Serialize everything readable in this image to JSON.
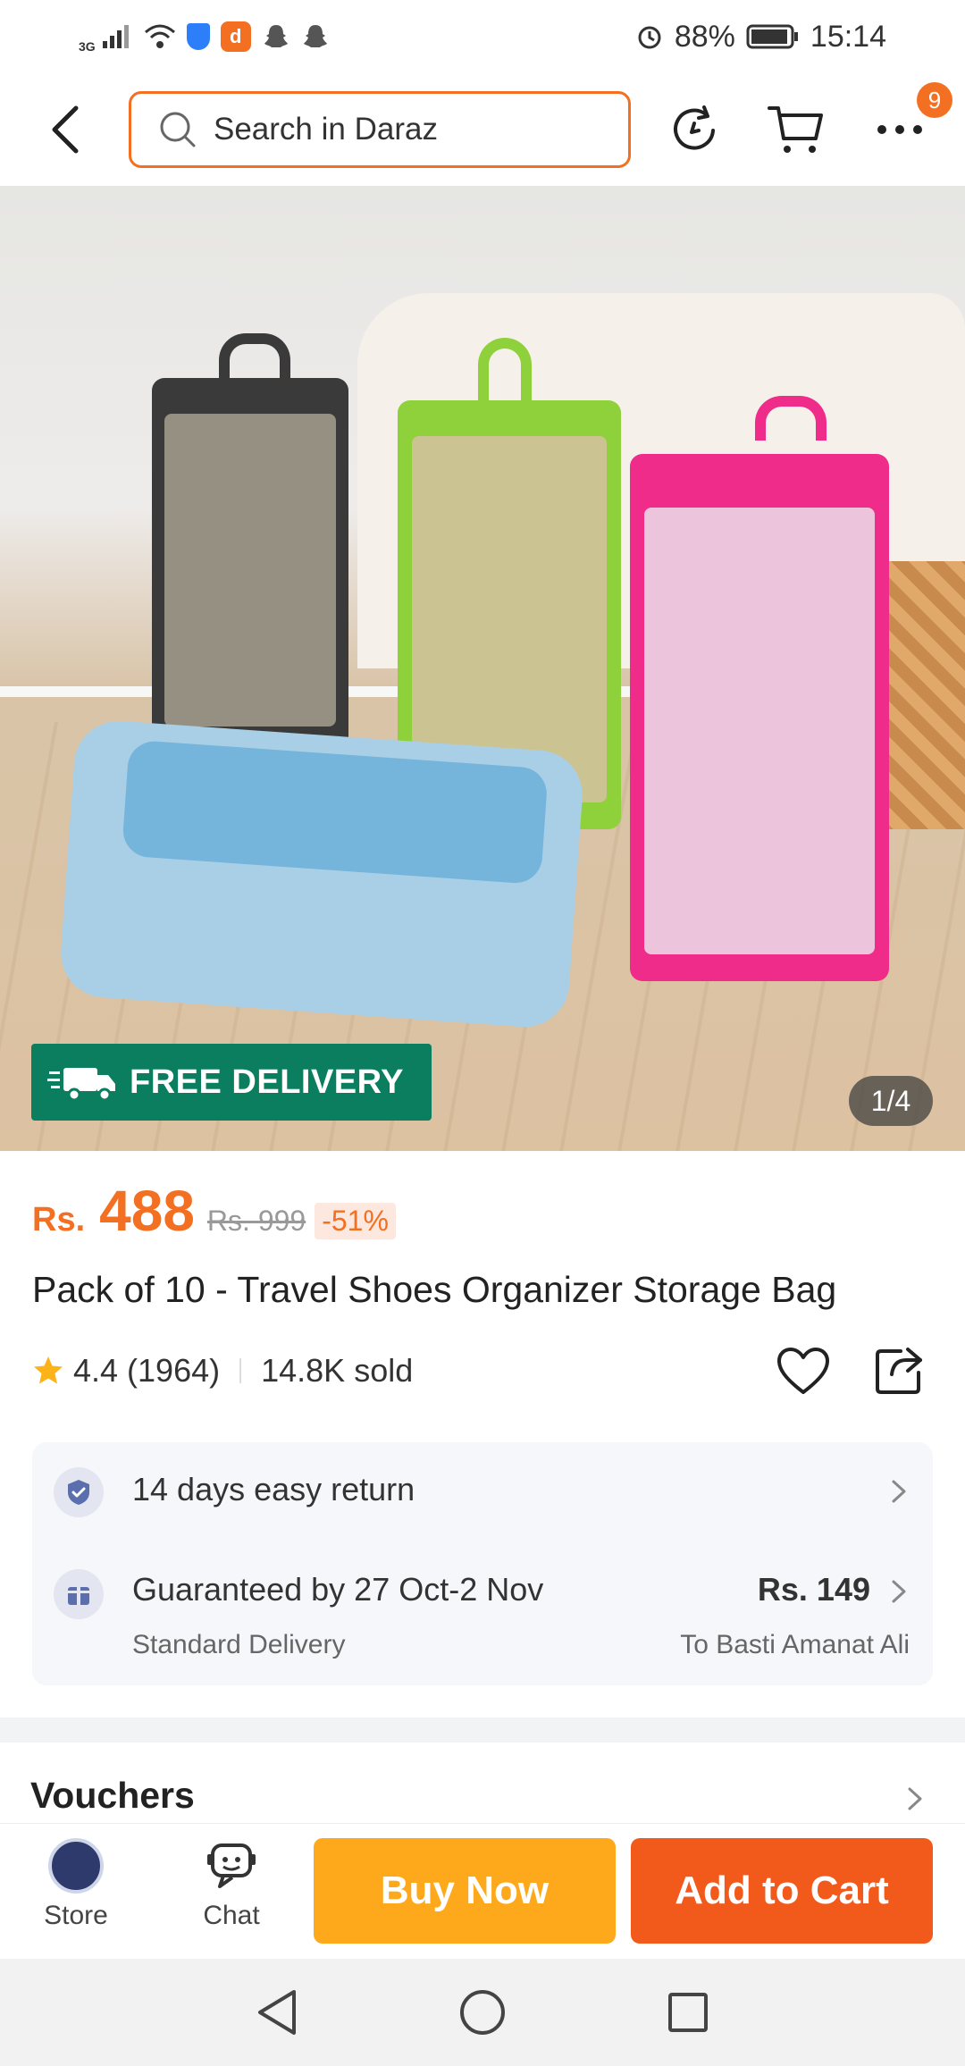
{
  "status_bar": {
    "network": "3G",
    "battery": "88%",
    "time": "15:14"
  },
  "header": {
    "search_placeholder": "Search in Daraz",
    "cart_badge": "9"
  },
  "product_image": {
    "free_delivery": "FREE DELIVERY",
    "counter": "1/4"
  },
  "product": {
    "currency": "Rs.",
    "price": "488",
    "old_price": "Rs. 999",
    "discount": "-51%",
    "title": "Pack of 10 - Travel Shoes Organizer Storage Bag",
    "rating": "4.4 (1964)",
    "sold": "14.8K sold"
  },
  "delivery": {
    "return_text": "14 days easy return",
    "guarantee_text": "Guaranteed by 27 Oct-2 Nov",
    "delivery_type": "Standard Delivery",
    "fee": "Rs. 149",
    "destination": "To Basti Amanat Ali"
  },
  "vouchers": {
    "title": "Vouchers"
  },
  "bottom_bar": {
    "store_label": "Store",
    "chat_label": "Chat",
    "buy_now": "Buy Now",
    "add_to_cart": "Add to Cart"
  },
  "colors": {
    "brand_orange": "#f36f21",
    "buy_now": "#fda91b",
    "add_to_cart": "#f25a1c",
    "free_delivery_green": "#0a7e5e"
  }
}
